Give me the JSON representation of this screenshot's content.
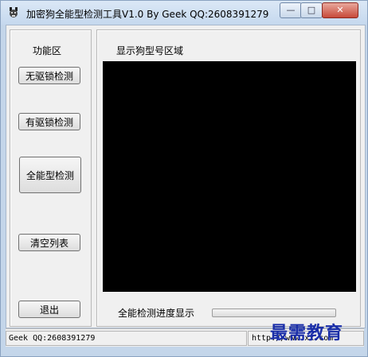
{
  "window": {
    "title": "加密狗全能型检测工具V1.0  By Geek QQ:2608391279",
    "controls": {
      "minimize": "—",
      "maximize": "□",
      "close": "✕"
    }
  },
  "left_panel": {
    "title": "功能区",
    "buttons": [
      {
        "label": "无驱锁检测"
      },
      {
        "label": "有驱锁检测"
      },
      {
        "label": "全能型检测"
      },
      {
        "label": "清空列表"
      },
      {
        "label": "退出"
      }
    ]
  },
  "right_panel": {
    "title": "显示狗型号区域",
    "progress_label": "全能检测进度显示",
    "progress_value": 0
  },
  "status": {
    "pane1": "Geek QQ:2608391279",
    "pane2": "http://www.xx.com"
  },
  "watermark": "最需教育",
  "colors": {
    "accent": "#1a2ea8",
    "display_bg": "#000000"
  }
}
